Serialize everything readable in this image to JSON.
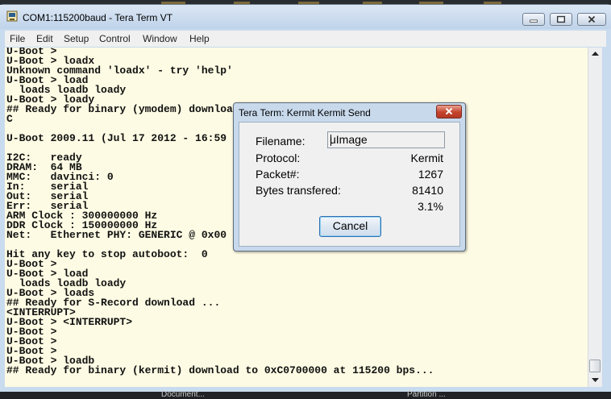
{
  "window": {
    "title": "COM1:115200baud - Tera Term VT"
  },
  "menubar": {
    "items": [
      "File",
      "Edit",
      "Setup",
      "Control",
      "Window",
      "Help"
    ]
  },
  "terminal": {
    "lines": [
      "U-Boot >",
      "U-Boot > loadx",
      "Unknown command 'loadx' - try 'help'",
      "U-Boot > load",
      "  loads loadb loady",
      "U-Boot > loady",
      "## Ready for binary (ymodem) download",
      "C",
      "",
      "U-Boot 2009.11 (Jul 17 2012 - 16:59",
      "",
      "I2C:   ready",
      "DRAM:  64 MB",
      "MMC:   davinci: 0",
      "In:    serial",
      "Out:   serial",
      "Err:   serial",
      "ARM Clock : 300000000 Hz",
      "DDR Clock : 150000000 Hz",
      "Net:   Ethernet PHY: GENERIC @ 0x00",
      "",
      "Hit any key to stop autoboot:  0",
      "U-Boot >",
      "U-Boot > load",
      "  loads loadb loady",
      "U-Boot > loads",
      "## Ready for S-Record download ...",
      "<INTERRUPT>",
      "U-Boot > <INTERRUPT>",
      "U-Boot >",
      "U-Boot >",
      "U-Boot >",
      "U-Boot > loadb",
      "## Ready for binary (kermit) download to 0xC0700000 at 115200 bps..."
    ]
  },
  "dialog": {
    "title": "Tera Term: Kermit Kermit Send",
    "filename_label": "Filename:",
    "filename_value": "uImage",
    "protocol_label": "Protocol:",
    "protocol_value": "Kermit",
    "packet_label": "Packet#:",
    "packet_value": "1267",
    "bytes_label": "Bytes transfered:",
    "bytes_value": "81410",
    "percent_value": "3.1%",
    "cancel_label": "Cancel"
  },
  "taskbar": {
    "items": [
      "Document...",
      "Partition ..."
    ]
  },
  "icons": {
    "app": "teraterm-app-icon",
    "minimize": "minimize-icon",
    "maximize": "maximize-icon",
    "close": "close-icon",
    "scroll_up": "scroll-up-arrow-icon",
    "scroll_down": "scroll-down-arrow-icon"
  },
  "colors": {
    "terminal_bg": "#fdfbe3",
    "terminal_fg": "#111111",
    "dialog_close": "#c5432c",
    "titlebar": "#c9dbee"
  }
}
